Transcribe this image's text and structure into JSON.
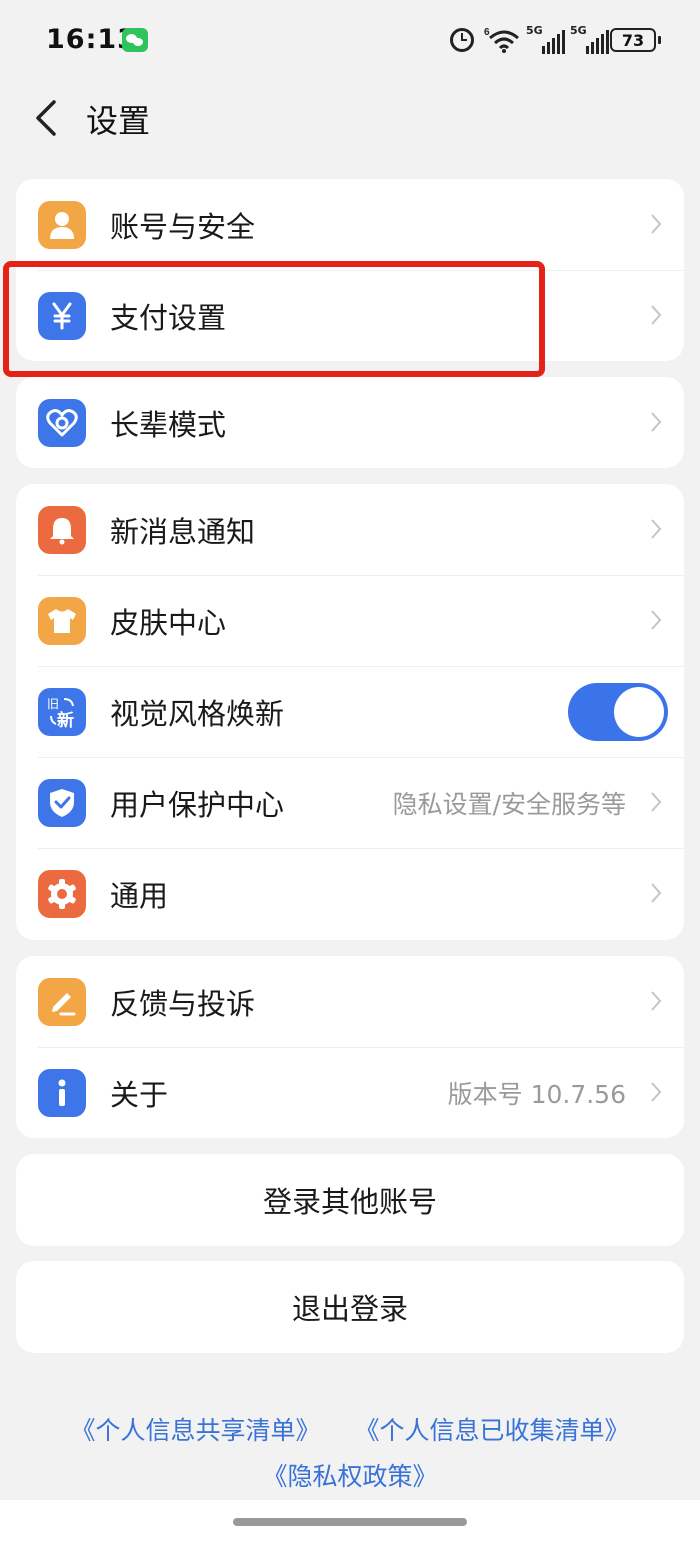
{
  "status_bar": {
    "time": "16:13",
    "battery": "73",
    "signal_1_label": "5G",
    "signal_2_label": "5G",
    "wifi_label": "6"
  },
  "nav": {
    "title": "设置"
  },
  "groups": {
    "account": [
      {
        "label": "账号与安全",
        "icon": "user-icon",
        "color": "#f2a646"
      },
      {
        "label": "支付设置",
        "icon": "yuan-icon",
        "color": "#3e76ea"
      }
    ],
    "elder": [
      {
        "label": "长辈模式",
        "icon": "heart-icon",
        "color": "#3e76ea"
      }
    ],
    "general": [
      {
        "label": "新消息通知",
        "icon": "bell-icon",
        "color": "#ec6a3f"
      },
      {
        "label": "皮肤中心",
        "icon": "shirt-icon",
        "color": "#f2a646"
      },
      {
        "label": "视觉风格焕新",
        "icon": "refresh-icon",
        "color": "#3e76ea",
        "icon_text_top": "旧",
        "icon_text_bottom": "新",
        "toggle_on": true
      },
      {
        "label": "用户保护中心",
        "icon": "shield-icon",
        "color": "#3e76ea",
        "sub": "隐私设置/安全服务等"
      },
      {
        "label": "通用",
        "icon": "gear-icon",
        "color": "#ec6a3f"
      }
    ],
    "support": [
      {
        "label": "反馈与投诉",
        "icon": "pen-icon",
        "color": "#f2a646"
      },
      {
        "label": "关于",
        "icon": "info-icon",
        "color": "#3e76ea",
        "sub": "版本号 10.7.56"
      }
    ]
  },
  "buttons": {
    "switch_account": "登录其他账号",
    "logout": "退出登录"
  },
  "footer": {
    "link_share": "《个人信息共享清单》",
    "link_collected": "《个人信息已收集清单》",
    "link_privacy": "《隐私权政策》"
  },
  "highlight_color": "#e52218"
}
